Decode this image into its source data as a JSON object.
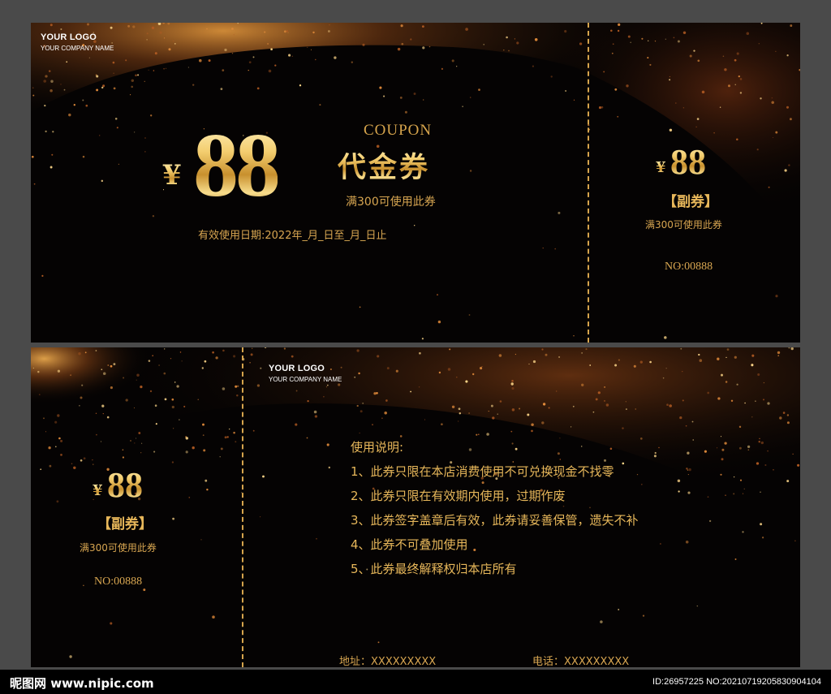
{
  "front": {
    "logo": "YOUR LOGO",
    "company": "YOUR COMPANY NAME",
    "currency": "¥",
    "amount": "88",
    "coupon_en": "COUPON",
    "coupon_cn": "代金券",
    "condition": "满300可使用此券",
    "validity": "有效使用日期:2022年_月_日至_月_日止"
  },
  "front_stub": {
    "currency": "¥",
    "amount": "88",
    "title": "【副券】",
    "condition": "满300可使用此券",
    "number": "NO:00888"
  },
  "back_stub": {
    "currency": "¥",
    "amount": "88",
    "title": "【副券】",
    "condition": "满300可使用此券",
    "number": "NO:00888"
  },
  "back": {
    "logo": "YOUR LOGO",
    "company": "YOUR COMPANY NAME",
    "instructions_title": "使用说明:",
    "instructions": [
      "1、此券只限在本店消费使用不可兑换现金不找零",
      "2、此券只限在有效期内使用，过期作废",
      "3、此券签字盖章后有效，此券请妥善保管，遗失不补",
      "4、此券不可叠加使用",
      "5、此券最终解释权归本店所有"
    ],
    "address_label": "地址：",
    "address_value": "XXXXXXXXX",
    "phone_label": "电话：",
    "phone_value": "XXXXXXXXX"
  },
  "watermark": {
    "site": "昵图网 www.nipic.com",
    "id": "ID:26957225 NO:20210719205830904104"
  },
  "colors": {
    "gold": "#e7b75a",
    "background": "#050303",
    "frame": "#4a4a4a"
  }
}
